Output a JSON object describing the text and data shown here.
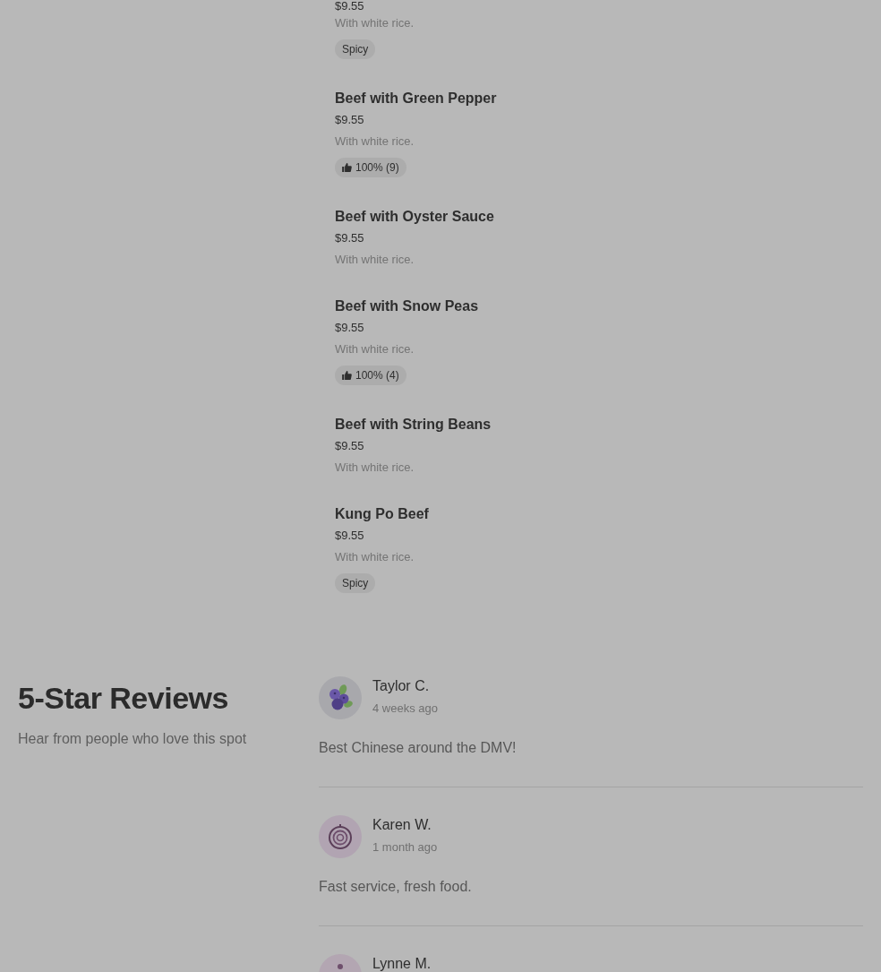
{
  "menu_items": [
    {
      "price": "$9.55",
      "description": "With white rice.",
      "badge": {
        "kind": "tag",
        "text": "Spicy"
      }
    },
    {
      "name": "Beef with Green Pepper",
      "price": "$9.55",
      "description": "With white rice.",
      "badge": {
        "kind": "rating",
        "text": "100% (9)"
      }
    },
    {
      "name": "Beef with Oyster Sauce",
      "price": "$9.55",
      "description": "With white rice."
    },
    {
      "name": "Beef with Snow Peas",
      "price": "$9.55",
      "description": "With white rice.",
      "badge": {
        "kind": "rating",
        "text": "100% (4)"
      }
    },
    {
      "name": "Beef with String Beans",
      "price": "$9.55",
      "description": "With white rice."
    },
    {
      "name": "Kung Po Beef",
      "price": "$9.55",
      "description": "With white rice.",
      "badge": {
        "kind": "tag",
        "text": "Spicy"
      }
    }
  ],
  "reviews_section": {
    "title": "5-Star Reviews",
    "subtitle": "Hear from people who love this spot",
    "reviews": [
      {
        "name": "Taylor C.",
        "time": "4 weeks ago",
        "text": "Best Chinese around the DMV!"
      },
      {
        "name": "Karen W.",
        "time": "1 month ago",
        "text": "Fast service, fresh food."
      },
      {
        "name": "Lynne M."
      }
    ]
  }
}
